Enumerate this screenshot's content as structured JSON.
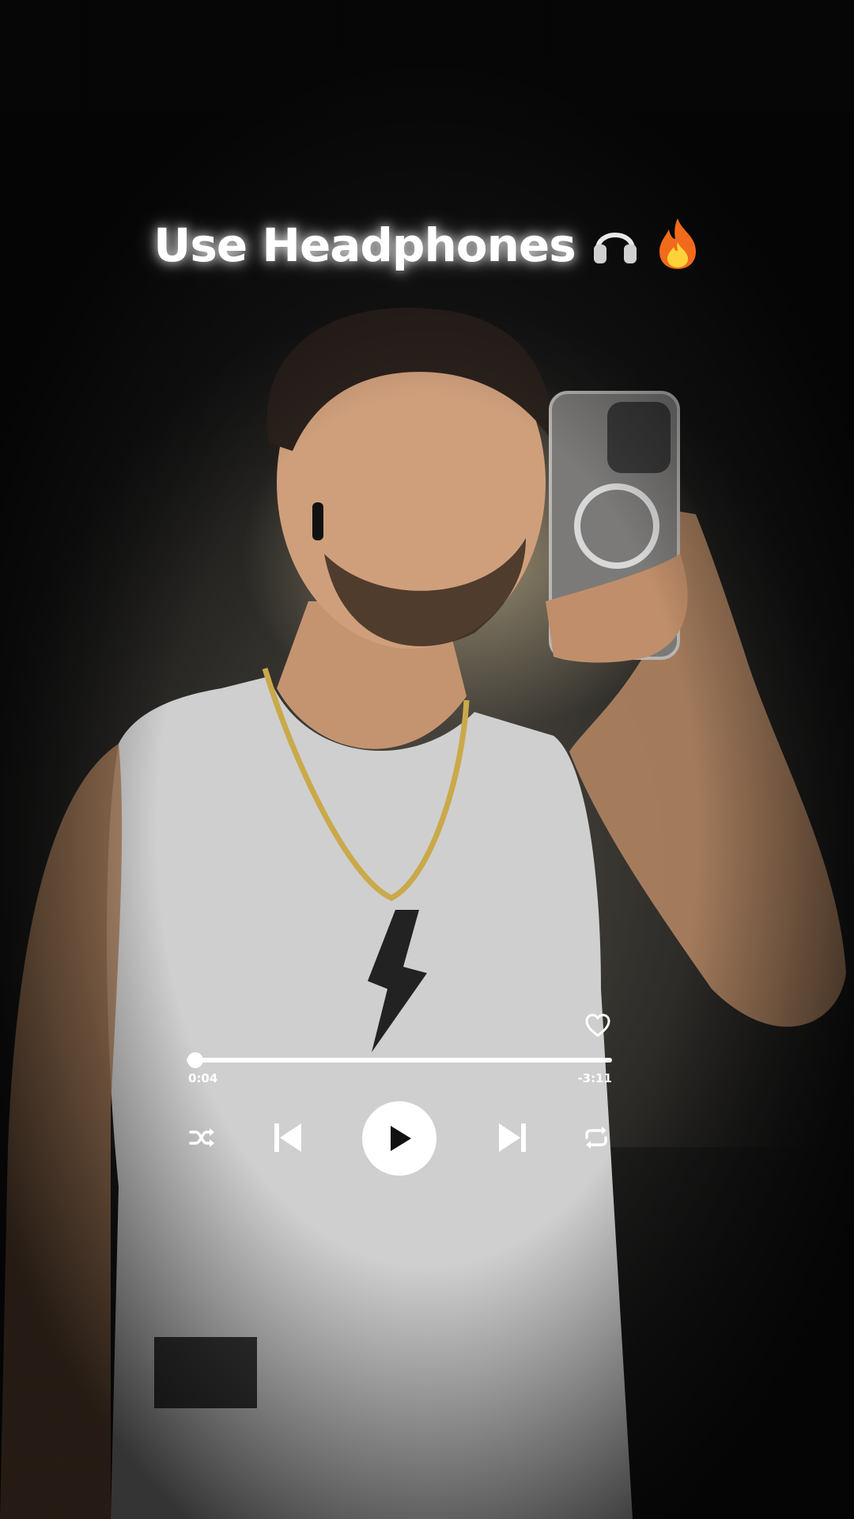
{
  "headline": {
    "text": "Use Headphones",
    "emojis": [
      "headphones-emoji",
      "fire-emoji"
    ]
  },
  "player": {
    "liked": false,
    "progress": {
      "elapsed": "0:04",
      "remaining": "-3:11",
      "fraction": 0.021
    },
    "controls": [
      "shuffle",
      "previous",
      "play",
      "next",
      "repeat"
    ]
  },
  "colors": {
    "player_foreground": "#ffffff",
    "play_icon": "#111111",
    "headline_glow": "#ffffff"
  }
}
